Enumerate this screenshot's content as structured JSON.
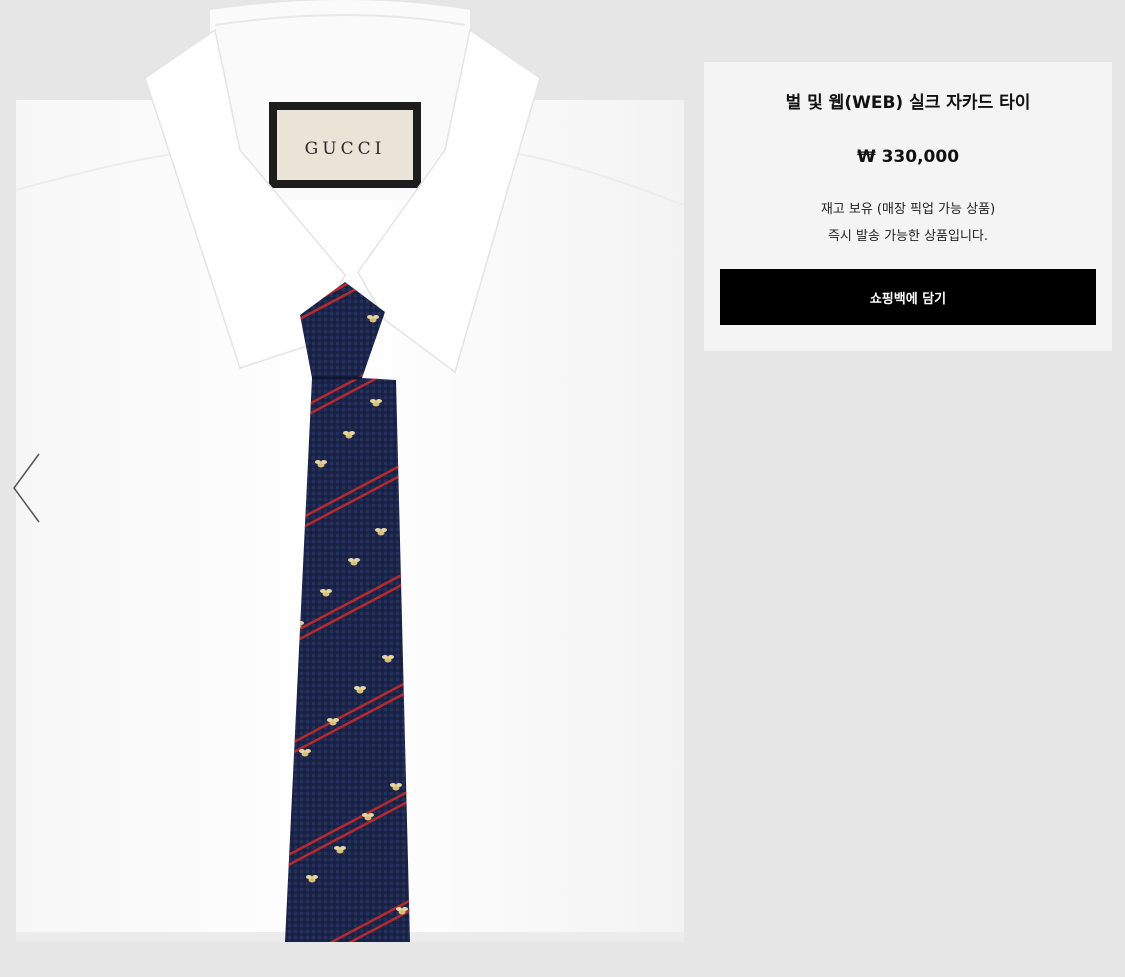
{
  "product": {
    "title": "벌 및 웹(WEB) 실크 자카드 타이",
    "price": "₩ 330,000",
    "stock_status": "재고 보유 (매장 픽업 가능 상품)",
    "shipping_note": "즉시 발송 가능한 상품입니다.",
    "add_to_bag_label": "쇼핑백에 담기"
  },
  "image": {
    "label_text": "GUCCI",
    "alt": "벌 및 웹(WEB) 실크 자카드 타이"
  },
  "gallery": {
    "prev_icon": "chevron-left-icon"
  },
  "colors": {
    "page_background": "#e6e6e6",
    "panel_background": "#f4f4f4",
    "button_background": "#000000",
    "button_text": "#ffffff",
    "tie_navy": "#1c2547",
    "stripe_red": "#b52a2e",
    "bee_gold": "#d8c07a"
  }
}
